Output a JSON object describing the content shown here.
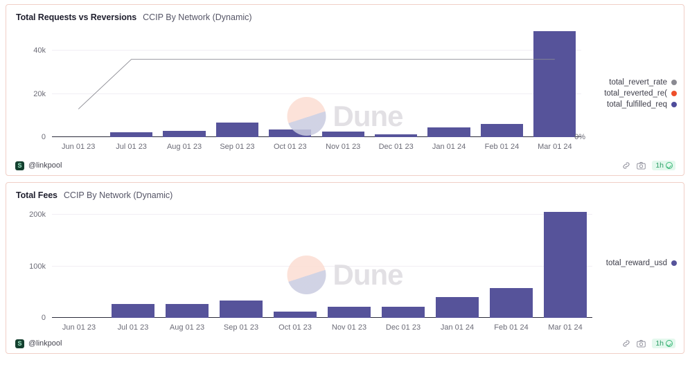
{
  "cards": [
    {
      "title": "Total Requests vs Reversions",
      "subtitle": "CCIP By Network (Dynamic)",
      "author": "@linkpool",
      "author_initial": "S",
      "refresh_label": "1h",
      "right_axis_label": "0%",
      "legend": [
        {
          "label": "total_revert_rate",
          "color": "#8a8a92"
        },
        {
          "label": "total_reverted_re(",
          "color": "#ee4f2b"
        },
        {
          "label": "total_fulfilled_req",
          "color": "#4f4c9b"
        }
      ],
      "tools": [
        {
          "icon": "link-icon"
        },
        {
          "icon": "camera-icon"
        }
      ]
    },
    {
      "title": "Total Fees",
      "subtitle": "CCIP By Network (Dynamic)",
      "author": "@linkpool",
      "author_initial": "S",
      "refresh_label": "1h",
      "right_axis_label": "",
      "legend": [
        {
          "label": "total_reward_usd",
          "color": "#56539a"
        }
      ],
      "tools": [
        {
          "icon": "link-icon"
        },
        {
          "icon": "camera-icon"
        }
      ]
    }
  ],
  "watermark": {
    "text": "Dune"
  },
  "chart_data": [
    {
      "type": "bar",
      "title": "Total Requests vs Reversions",
      "subtitle": "CCIP By Network (Dynamic)",
      "xlabel": "",
      "ylabel": "",
      "ylim": [
        0,
        50000
      ],
      "yticks": [
        0,
        20000,
        40000
      ],
      "ytick_labels": [
        "0",
        "20k",
        "40k"
      ],
      "grid": true,
      "legend_position": "right",
      "categories": [
        "Jun 01 23",
        "Jul 01 23",
        "Aug 01 23",
        "Sep 01 23",
        "Oct 01 23",
        "Nov 01 23",
        "Dec 01 23",
        "Jan 01 24",
        "Feb 01 24",
        "Mar 01 24"
      ],
      "series": [
        {
          "name": "total_fulfilled_req",
          "type": "bar",
          "color": "#56539a",
          "values": [
            0,
            2200,
            2800,
            6800,
            3600,
            2700,
            1200,
            4500,
            6000,
            49000
          ]
        },
        {
          "name": "total_reverted_re(",
          "type": "bar",
          "color": "#ee4f2b",
          "values": [
            0,
            0,
            0,
            0,
            0,
            0,
            0,
            0,
            0,
            0
          ]
        },
        {
          "name": "total_revert_rate",
          "type": "line",
          "color": "#8a8a92",
          "axis": "right",
          "values": [
            13000,
            36000,
            36000,
            36000,
            36000,
            36000,
            36000,
            36000,
            36000,
            36000
          ]
        }
      ],
      "right_axis": {
        "ticks": [
          "0%"
        ]
      }
    },
    {
      "type": "bar",
      "title": "Total Fees",
      "subtitle": "CCIP By Network (Dynamic)",
      "xlabel": "",
      "ylabel": "",
      "ylim": [
        0,
        215000
      ],
      "yticks": [
        0,
        100000,
        200000
      ],
      "ytick_labels": [
        "0",
        "100k",
        "200k"
      ],
      "grid": true,
      "legend_position": "right",
      "categories": [
        "Jun 01 23",
        "Jul 01 23",
        "Aug 01 23",
        "Sep 01 23",
        "Oct 01 23",
        "Nov 01 23",
        "Dec 01 23",
        "Jan 01 24",
        "Feb 01 24",
        "Mar 01 24"
      ],
      "series": [
        {
          "name": "total_reward_usd",
          "type": "bar",
          "color": "#56539a",
          "values": [
            0,
            27000,
            27000,
            33000,
            12000,
            22000,
            21000,
            40000,
            58000,
            205000
          ]
        }
      ]
    }
  ]
}
